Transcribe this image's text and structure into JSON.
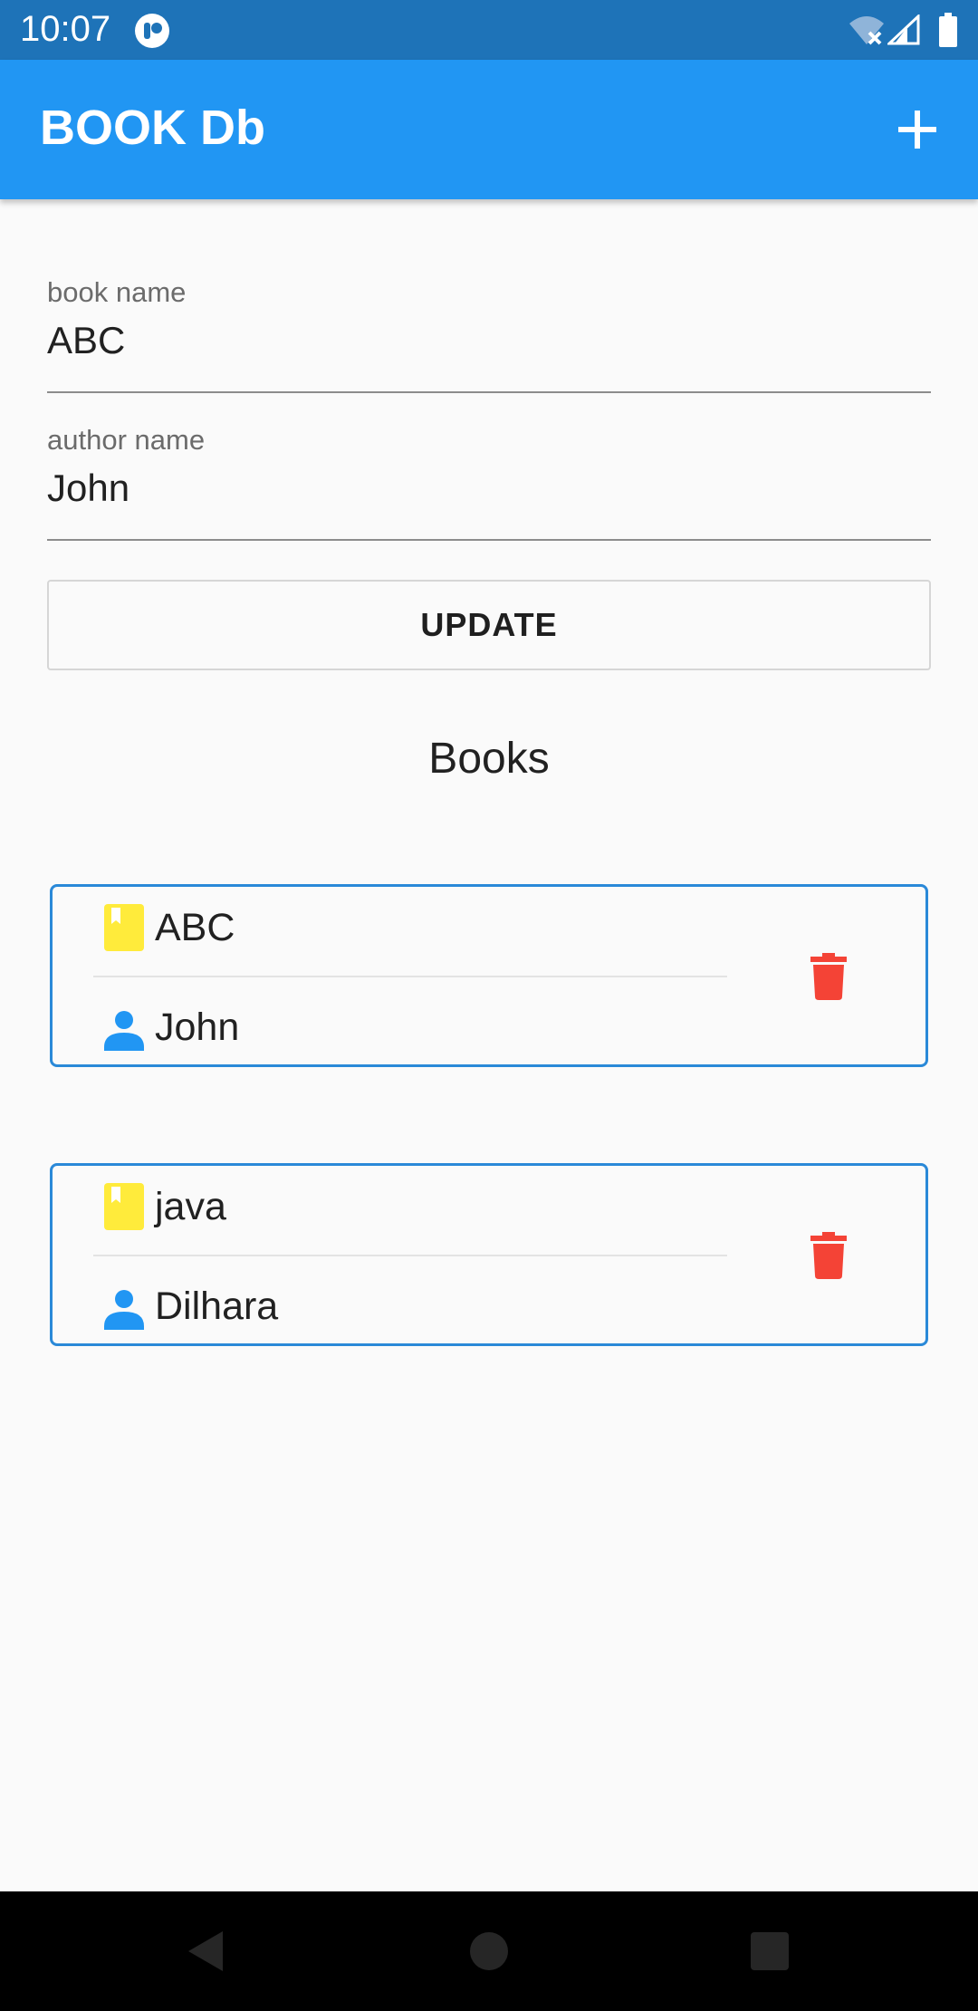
{
  "status_bar": {
    "time": "10:07"
  },
  "app_bar": {
    "title": "BOOK Db",
    "add_icon": "plus-icon"
  },
  "form": {
    "book_name": {
      "label": "book name",
      "value": "ABC"
    },
    "author_name": {
      "label": "author name",
      "value": "John"
    },
    "update_label": "UPDATE"
  },
  "books_section": {
    "title": "Books",
    "items": [
      {
        "book": "ABC",
        "author": "John"
      },
      {
        "book": "java",
        "author": "Dilhara"
      }
    ]
  },
  "colors": {
    "status_bar": "#1e73b8",
    "app_bar": "#2196f3",
    "card_border": "#2a89d8",
    "book_icon": "#ffeb3b",
    "person_icon": "#2196f3",
    "delete_icon": "#f44336"
  },
  "icons": {
    "book": "bookmark-book-icon",
    "author": "person-icon",
    "delete": "trash-icon"
  }
}
